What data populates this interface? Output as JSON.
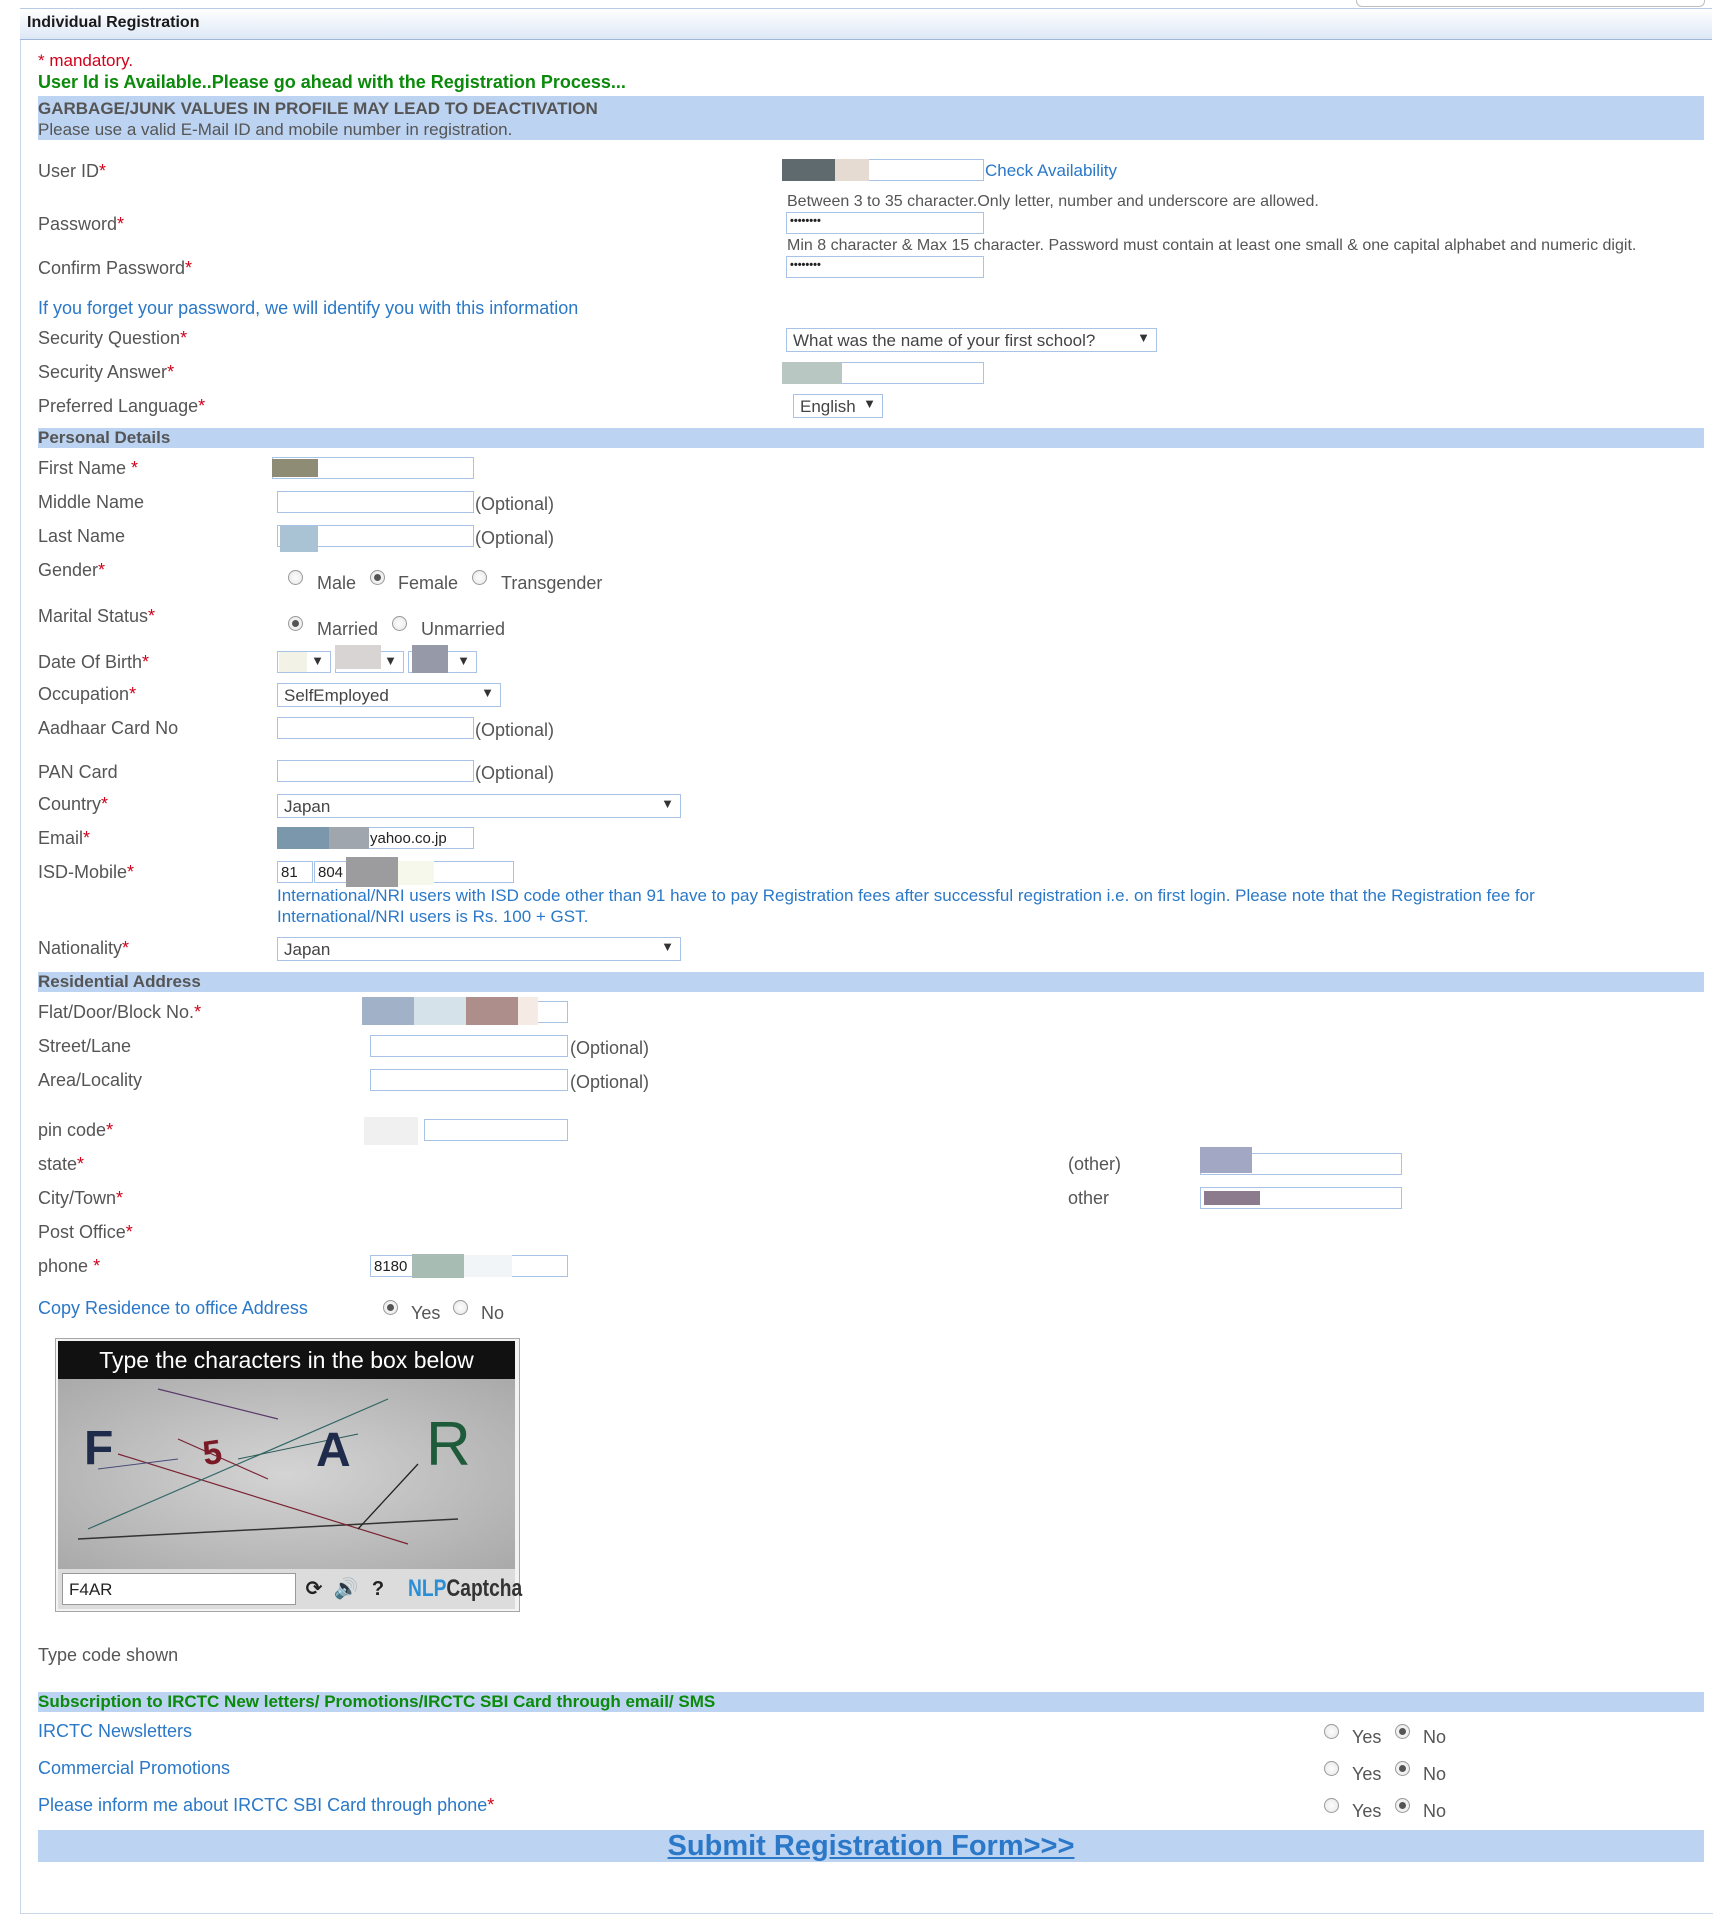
{
  "header": {
    "title": "Individual Registration"
  },
  "messages": {
    "mandatory": "* mandatory.",
    "available": "User Id is Available..Please go ahead with the Registration Process...",
    "warning_title": "GARBAGE/JUNK VALUES IN PROFILE MAY LEAD TO DEACTIVATION",
    "warning_sub": "Please use a valid E-Mail ID and mobile number in registration."
  },
  "account": {
    "user_id_label": "User ID",
    "check_availability": "Check Availability",
    "user_id_hint": "Between 3 to 35 character.Only letter, number and underscore are allowed.",
    "password_label": "Password",
    "password_value": "••••••••",
    "password_hint": "Min 8 character & Max 15 character. Password must contain at least one small & one capital alphabet and numeric digit.",
    "confirm_label": "Confirm Password",
    "confirm_value": "••••••••",
    "forget_info": "If you forget your password, we will identify you with this information",
    "security_q_label": "Security Question",
    "security_q_value": "What was the name of your first school?",
    "security_a_label": "Security Answer",
    "language_label": "Preferred Language",
    "language_value": "English"
  },
  "personal": {
    "section": "Personal Details",
    "first_name": "First Name",
    "middle_name": "Middle Name",
    "last_name": "Last Name",
    "optional": "(Optional)",
    "gender": "Gender",
    "gender_options": [
      "Male",
      "Female",
      "Transgender"
    ],
    "marital": "Marital Status",
    "marital_options": [
      "Married",
      "Unmarried"
    ],
    "dob": "Date Of Birth",
    "occupation": "Occupation",
    "occupation_value": "SelfEmployed",
    "aadhaar": "Aadhaar Card No",
    "pan": "PAN Card",
    "country": "Country",
    "country_value": "Japan",
    "email": "Email",
    "email_value": "yahoo.co.jp",
    "isd_mobile": "ISD-Mobile",
    "isd_value": "81",
    "mobile_value": "804",
    "isd_note_1": "International/NRI users with ISD code other than 91 have to pay Registration fees after successful registration i.e. on first login. Please note that the Registration fee for",
    "isd_note_2": "International/NRI users is Rs. 100 + GST.",
    "nationality": "Nationality",
    "nationality_value": "Japan"
  },
  "address": {
    "section": "Residential Address",
    "flat": "Flat/Door/Block No.",
    "street": "Street/Lane",
    "area": "Area/Locality",
    "pin": "pin code",
    "state": "state",
    "state_other": "(other)",
    "city": "City/Town",
    "city_other": "other",
    "post_office": "Post Office",
    "phone": "phone",
    "phone_value": "8180",
    "copy_label": "Copy Residence to office Address",
    "yes": "Yes",
    "no": "No"
  },
  "captcha": {
    "title": "Type the characters in the box below",
    "chars": [
      "F",
      "5",
      "A",
      "R"
    ],
    "value": "F4AR",
    "brand_nlp": "NLP",
    "brand_captcha": "Captcha",
    "type_code": "Type code shown"
  },
  "subscription": {
    "section": "Subscription to IRCTC New letters/ Promotions/IRCTC SBI Card through email/ SMS",
    "newsletters": "IRCTC Newsletters",
    "promotions": "Commercial Promotions",
    "sbi_card": "Please inform me about IRCTC SBI Card through phone",
    "yes": "Yes",
    "no": "No"
  },
  "submit": {
    "label": "Submit Registration Form>>>"
  },
  "colors": {
    "accent": "#2a78c7",
    "band": "#bcd3f2",
    "required": "#d0021b",
    "success": "#0b8a0b"
  }
}
